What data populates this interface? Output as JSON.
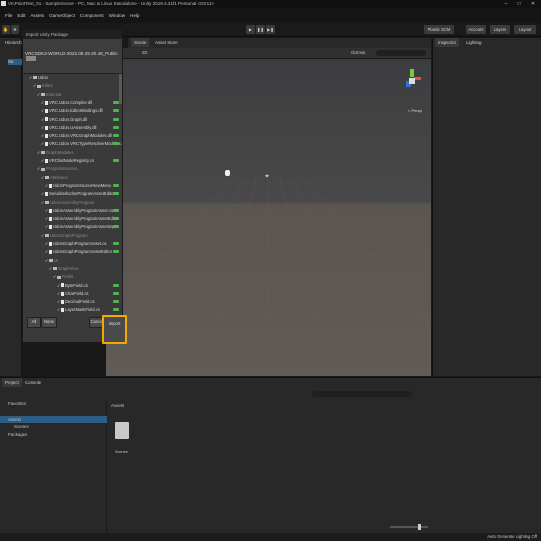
{
  "window": {
    "title": "VrcPointTest_01 - SampleScene - PC, Mac & Linux Standalone - Unity 2019.4.31f1 Personal <DX11>"
  },
  "menu": [
    "File",
    "Edit",
    "Assets",
    "GameObject",
    "Component",
    "Window",
    "Help"
  ],
  "toolbar": {
    "plastic": "Plastic SCM",
    "account": "Account",
    "layers": "Layers",
    "layout": "Layout"
  },
  "hierarchy": {
    "tab": "Hierarchy",
    "item": "Sa"
  },
  "scene": {
    "tabs": [
      "Scene",
      "Asset Store"
    ],
    "shading": "2D",
    "gizmos": "Gizmos",
    "persp": "< Persp"
  },
  "inspector": {
    "tabs": [
      "Inspector",
      "Lighting"
    ]
  },
  "dialog": {
    "title": "Import Unity Package",
    "package": "VRCSDK3-WORLD-2022.08.29.20.48_Public",
    "items": [
      {
        "label": "Udon",
        "level": 0,
        "type": "folder",
        "dim": false,
        "new": false
      },
      {
        "label": "Editor",
        "level": 1,
        "type": "folder",
        "dim": true,
        "new": false
      },
      {
        "label": "External",
        "level": 2,
        "type": "folder",
        "dim": true,
        "new": false
      },
      {
        "label": "VRC.Udon.Compiler.dll",
        "level": 3,
        "type": "file",
        "dim": false,
        "new": true
      },
      {
        "label": "VRC.Udon.EditorBindings.dll",
        "level": 3,
        "type": "file",
        "dim": false,
        "new": true
      },
      {
        "label": "VRC.Udon.Graph.dll",
        "level": 3,
        "type": "file",
        "dim": false,
        "new": true
      },
      {
        "label": "VRC.Udon.UAssembly.dll",
        "level": 3,
        "type": "file",
        "dim": false,
        "new": true
      },
      {
        "label": "VRC.Udon.VRCGraphModules.dll",
        "level": 3,
        "type": "file",
        "dim": false,
        "new": true
      },
      {
        "label": "VRC.Udon.VRCTypeResolverModules.dll",
        "level": 3,
        "type": "file",
        "dim": false,
        "new": true
      },
      {
        "label": "GraphModules",
        "level": 2,
        "type": "folder",
        "dim": true,
        "new": false
      },
      {
        "label": "VRChatNodeRegistry.cs",
        "level": 3,
        "type": "file",
        "dim": false,
        "new": true
      },
      {
        "label": "ProgramSources",
        "level": 2,
        "type": "folder",
        "dim": true,
        "new": false
      },
      {
        "label": "Attributes",
        "level": 3,
        "type": "folder",
        "dim": true,
        "new": false
      },
      {
        "label": "UdonProgramSourceNewMenu",
        "level": 4,
        "type": "file",
        "dim": false,
        "new": true
      },
      {
        "label": "SerializedUdonProgramAssetEditor",
        "level": 3,
        "type": "file",
        "dim": false,
        "new": true
      },
      {
        "label": "UdonAssemblyProgram",
        "level": 3,
        "type": "folder",
        "dim": true,
        "new": false
      },
      {
        "label": "UdonAssemblyProgramAsset.cs",
        "level": 4,
        "type": "file",
        "dim": false,
        "new": true
      },
      {
        "label": "UdonAssemblyProgramAssetEditor",
        "level": 4,
        "type": "file",
        "dim": false,
        "new": true
      },
      {
        "label": "UdonAssemblyProgramAssetImp",
        "level": 4,
        "type": "file",
        "dim": false,
        "new": true
      },
      {
        "label": "UdonGraphProgram",
        "level": 3,
        "type": "folder",
        "dim": true,
        "new": false
      },
      {
        "label": "UdonGraphProgramAsset.cs",
        "level": 4,
        "type": "file",
        "dim": false,
        "new": true
      },
      {
        "label": "UdonGraphProgramAssetEditor",
        "level": 4,
        "type": "file",
        "dim": false,
        "new": true
      },
      {
        "label": "UI",
        "level": 4,
        "type": "folder",
        "dim": true,
        "new": false
      },
      {
        "label": "GraphView",
        "level": 5,
        "type": "folder",
        "dim": true,
        "new": false
      },
      {
        "label": "Fields",
        "level": 6,
        "type": "folder",
        "dim": true,
        "new": false
      },
      {
        "label": "ByteField.cs",
        "level": 7,
        "type": "file",
        "dim": false,
        "new": true
      },
      {
        "label": "CharField.cs",
        "level": 7,
        "type": "file",
        "dim": false,
        "new": true
      },
      {
        "label": "DecimalField.cs",
        "level": 7,
        "type": "file",
        "dim": false,
        "new": true
      },
      {
        "label": "LayerMaskField.cs",
        "level": 7,
        "type": "file",
        "dim": false,
        "new": true
      }
    ],
    "buttons": {
      "all": "All",
      "none": "None",
      "cancel": "Cancel",
      "import": "Import"
    }
  },
  "project": {
    "tabs": [
      "Project",
      "Console"
    ],
    "tree": [
      "Favorites",
      "Assets",
      "Scenes",
      "Packages"
    ],
    "assets_header": "Assets",
    "folder_label": "Scenes"
  },
  "status": {
    "text": "Auto Generate Lighting Off"
  },
  "colors": {
    "highlight": "#f2a900",
    "new_badge": "#4fb350"
  }
}
